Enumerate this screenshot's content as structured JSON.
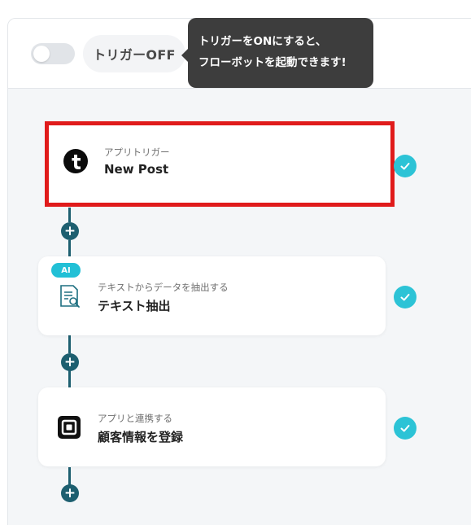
{
  "header": {
    "trigger_label": "トリガーOFF",
    "tooltip_line1": "トリガーをONにすると、",
    "tooltip_line2": "フローボットを起動できます!",
    "trigger_state": "off"
  },
  "steps": [
    {
      "subtitle": "アプリトリガー",
      "title": "New Post",
      "icon": "tumblr-icon",
      "status": "done",
      "selected": true
    },
    {
      "subtitle": "テキストからデータを抽出する",
      "title": "テキスト抽出",
      "icon": "document-search-icon",
      "status": "done",
      "badge": "AI"
    },
    {
      "subtitle": "アプリと連携する",
      "title": "顧客情報を登録",
      "icon": "square-app-icon",
      "status": "done"
    }
  ],
  "colors": {
    "connector": "#1d5f70",
    "check": "#2cc3d6",
    "selection": "#e01b1b",
    "ai_badge": "#22c0d6"
  }
}
